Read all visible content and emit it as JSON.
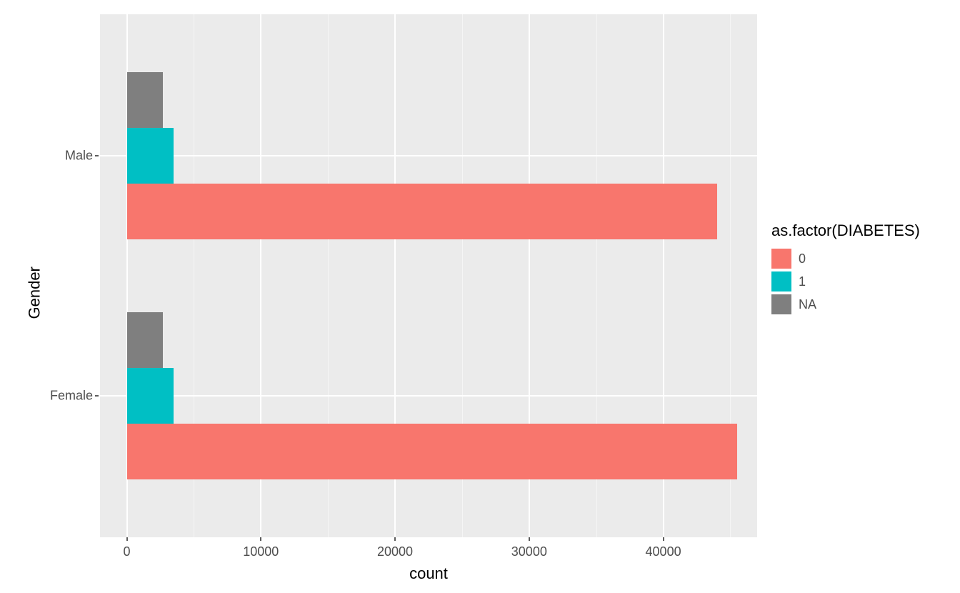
{
  "chart_data": {
    "type": "bar",
    "orientation": "horizontal",
    "grouping": "dodge",
    "categories": [
      "Female",
      "Male"
    ],
    "series": [
      {
        "name": "0",
        "color": "#F8766D",
        "values": [
          45500,
          44000
        ]
      },
      {
        "name": "1",
        "color": "#00BFC4",
        "values": [
          3500,
          3500
        ]
      },
      {
        "name": "NA",
        "color": "#7F7F7F",
        "values": [
          2700,
          2700
        ]
      }
    ],
    "xlabel": "count",
    "ylabel": "Gender",
    "x_ticks": [
      0,
      10000,
      20000,
      30000,
      40000
    ],
    "xlim": [
      -2000,
      47000
    ],
    "legend_title": "as.factor(DIABETES)"
  },
  "colors": {
    "panel_bg": "#ebebeb",
    "grid_major": "#ffffff"
  }
}
